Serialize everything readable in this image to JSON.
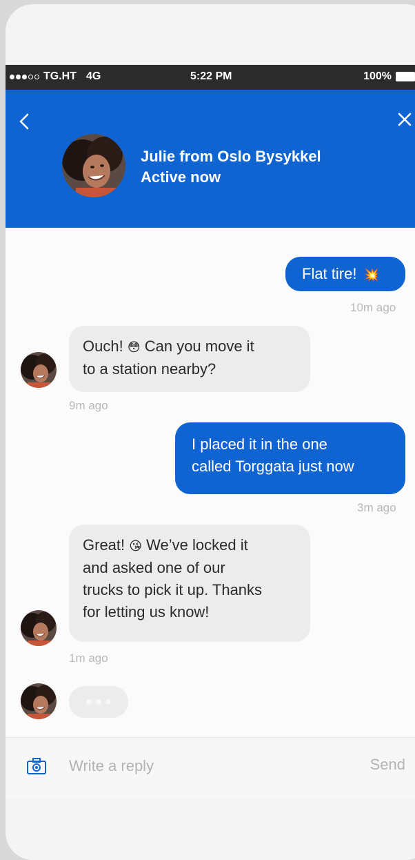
{
  "status_bar": {
    "carrier": "TG.HT",
    "network": "4G",
    "time": "5:22 PM",
    "battery": "100%"
  },
  "header": {
    "agent_name": "Julie from Oslo Bysykkel",
    "agent_status": "Active now",
    "accent_color": "#0f64d2"
  },
  "messages": [
    {
      "sender": "user",
      "text": "Flat tire!",
      "emoji": "💥",
      "time": "10m ago"
    },
    {
      "sender": "agent",
      "line1_a": "Ouch!",
      "emoji": "😳",
      "line1_b": "Can you move it",
      "line2": "to a station nearby?",
      "time": "9m ago"
    },
    {
      "sender": "user",
      "line1": "I placed it in the one",
      "line2": "called Torggata just now",
      "time": "3m ago"
    },
    {
      "sender": "agent",
      "line1_a": "Great!",
      "emoji": "😘",
      "line1_b": "We’ve locked it",
      "line2": "and asked one of our",
      "line3": "trucks to pick it up. Thanks",
      "line4": "for letting us know!",
      "time": "1m ago"
    }
  ],
  "composer": {
    "placeholder": "Write a reply",
    "value": "",
    "send_label": "Send"
  },
  "icons": {
    "back": "chevron-left-icon",
    "close": "close-icon",
    "camera": "camera-icon"
  }
}
